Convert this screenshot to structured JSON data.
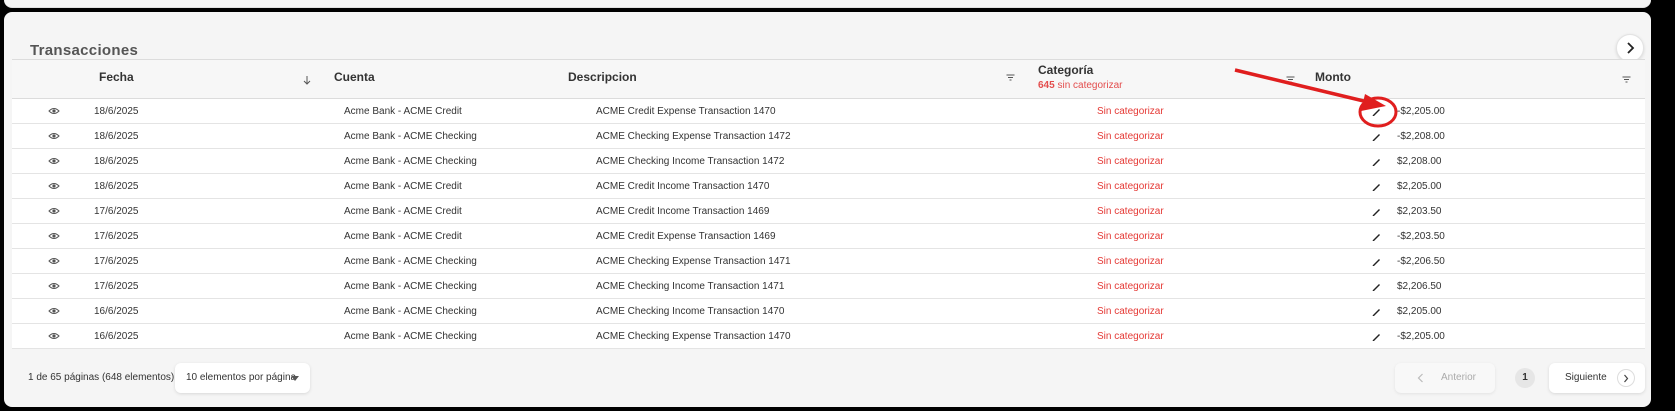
{
  "card": {
    "title": "Transacciones"
  },
  "headers": {
    "fecha": "Fecha",
    "cuenta": "Cuenta",
    "descripcion": "Descripcion",
    "categoria": "Categoría",
    "categoria_count": "645",
    "categoria_sub": "sin categorizar",
    "monto": "Monto"
  },
  "rows": [
    {
      "fecha": "18/6/2025",
      "cuenta": "Acme Bank - ACME Credit",
      "descripcion": "ACME Credit Expense Transaction 1470",
      "categoria": "Sin categorizar",
      "monto": "-$2,205.00"
    },
    {
      "fecha": "18/6/2025",
      "cuenta": "Acme Bank - ACME Checking",
      "descripcion": "ACME Checking Expense Transaction 1472",
      "categoria": "Sin categorizar",
      "monto": "-$2,208.00"
    },
    {
      "fecha": "18/6/2025",
      "cuenta": "Acme Bank - ACME Checking",
      "descripcion": "ACME Checking Income Transaction 1472",
      "categoria": "Sin categorizar",
      "monto": "$2,208.00"
    },
    {
      "fecha": "18/6/2025",
      "cuenta": "Acme Bank - ACME Credit",
      "descripcion": "ACME Credit Income Transaction 1470",
      "categoria": "Sin categorizar",
      "monto": "$2,205.00"
    },
    {
      "fecha": "17/6/2025",
      "cuenta": "Acme Bank - ACME Credit",
      "descripcion": "ACME Credit Income Transaction 1469",
      "categoria": "Sin categorizar",
      "monto": "$2,203.50"
    },
    {
      "fecha": "17/6/2025",
      "cuenta": "Acme Bank - ACME Credit",
      "descripcion": "ACME Credit Expense Transaction 1469",
      "categoria": "Sin categorizar",
      "monto": "-$2,203.50"
    },
    {
      "fecha": "17/6/2025",
      "cuenta": "Acme Bank - ACME Checking",
      "descripcion": "ACME Checking Expense Transaction 1471",
      "categoria": "Sin categorizar",
      "monto": "-$2,206.50"
    },
    {
      "fecha": "17/6/2025",
      "cuenta": "Acme Bank - ACME Checking",
      "descripcion": "ACME Checking Income Transaction 1471",
      "categoria": "Sin categorizar",
      "monto": "$2,206.50"
    },
    {
      "fecha": "16/6/2025",
      "cuenta": "Acme Bank - ACME Checking",
      "descripcion": "ACME Checking Income Transaction 1470",
      "categoria": "Sin categorizar",
      "monto": "$2,205.00"
    },
    {
      "fecha": "16/6/2025",
      "cuenta": "Acme Bank - ACME Checking",
      "descripcion": "ACME Checking Expense Transaction 1470",
      "categoria": "Sin categorizar",
      "monto": "-$2,205.00"
    }
  ],
  "footer": {
    "range": "1 de 65 páginas (648 elementos)",
    "per_page": "10 elementos por página",
    "prev": "Anterior",
    "page": "1",
    "next": "Siguiente"
  },
  "colors": {
    "category_red": "#e53935",
    "annotation_red": "#e01e1e"
  },
  "icons": {
    "row_view": "eye-icon",
    "row_edit": "pencil-icon",
    "filter": "filter-icon",
    "sort": "sort-down-arrow-icon"
  }
}
